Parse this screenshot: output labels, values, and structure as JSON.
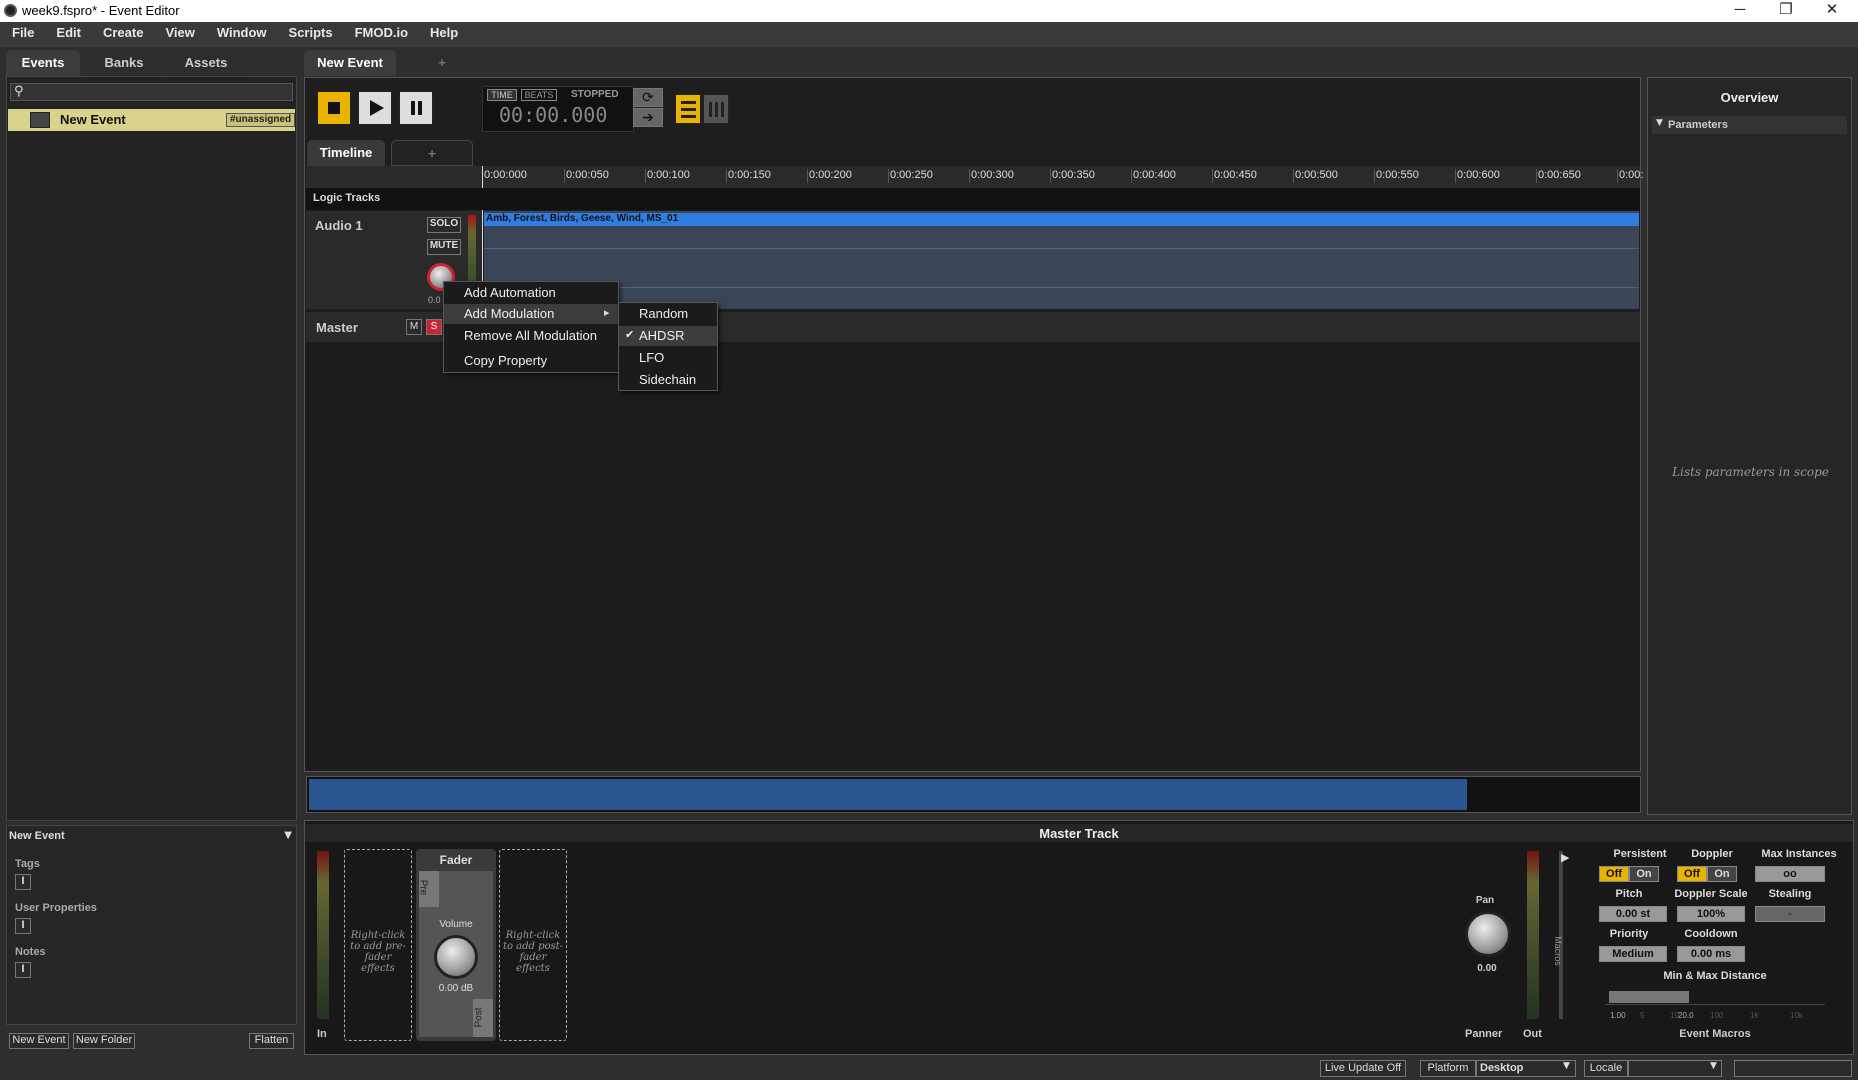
{
  "window": {
    "title": "week9.fspro* - Event Editor",
    "minimize": "─",
    "restore": "❐",
    "close": "✕"
  },
  "menu": [
    "File",
    "Edit",
    "Create",
    "View",
    "Window",
    "Scripts",
    "FMOD.io",
    "Help"
  ],
  "left": {
    "tabs": [
      "Events",
      "Banks",
      "Assets"
    ],
    "search_placeholder": "",
    "event": {
      "name": "New Event",
      "tag": "#unassigned"
    },
    "props": {
      "title": "New Event",
      "tags": "Tags",
      "user_properties": "User Properties",
      "notes": "Notes"
    },
    "buttons": {
      "new_event": "New Event",
      "new_folder": "New Folder",
      "flatten": "Flatten"
    }
  },
  "center": {
    "tab": "New Event",
    "add_tab": "+",
    "transport": {
      "time": "TIME",
      "beats": "BEATS",
      "status": "STOPPED",
      "clock": "00:00.000"
    },
    "timeline_tab": "Timeline",
    "timeline_add": "+",
    "ruler": [
      "0:00:000",
      "0:00:050",
      "0:00:100",
      "0:00:150",
      "0:00:200",
      "0:00:250",
      "0:00:300",
      "0:00:350",
      "0:00:400",
      "0:00:450",
      "0:00:500",
      "0:00:550",
      "0:00:600",
      "0:00:650",
      "0:00:"
    ],
    "logic_tracks": "Logic Tracks",
    "track": {
      "name": "Audio 1",
      "solo": "SOLO",
      "mute": "MUTE",
      "vol": "0.0",
      "clip": "Amb, Forest, Birds, Geese, Wind, MS_01"
    },
    "master": {
      "name": "Master",
      "m": "M",
      "s": "S"
    }
  },
  "context_menu": {
    "items": [
      "Add Automation",
      "Add Modulation",
      "Remove All Modulation",
      "Copy Property"
    ],
    "arrow": "▸"
  },
  "submenu": {
    "items": [
      "Random",
      "AHDSR",
      "LFO",
      "Sidechain"
    ],
    "checked": "AHDSR",
    "check": "✔"
  },
  "overview": {
    "title": "Overview",
    "section": "Parameters",
    "empty": "Lists parameters in scope"
  },
  "master_track": {
    "title": "Master Track",
    "pre_hint": "Right-click to add pre-fader effects",
    "post_hint": "Right-click to add post-fader effects",
    "fader": "Fader",
    "pre": "Pre",
    "post": "Post",
    "volume": "Volume",
    "volume_value": "0.00 dB",
    "in": "In",
    "out": "Out",
    "pan": "Pan",
    "pan_value": "0.00",
    "panner": "Panner",
    "macros": "Macros",
    "event_macros": {
      "title": "Event Macros",
      "persistent": "Persistent",
      "doppler": "Doppler",
      "max_instances": "Max Instances",
      "off": "Off",
      "on": "On",
      "max_value": "oo",
      "pitch": "Pitch",
      "pitch_value": "0.00 st",
      "doppler_scale": "Doppler Scale",
      "doppler_scale_value": "100%",
      "stealing": "Stealing",
      "stealing_value": "-",
      "priority": "Priority",
      "priority_value": "Medium",
      "cooldown": "Cooldown",
      "cooldown_value": "0.00 ms",
      "min_max": "Min & Max Distance",
      "min_value": "1.00",
      "max_value2": "20.0",
      "scale": [
        "1",
        "5",
        "10",
        "100",
        "1k",
        "10k"
      ]
    }
  },
  "statusbar": {
    "live_update": "Live Update Off",
    "platform_label": "Platform",
    "platform": "Desktop",
    "locale_label": "Locale",
    "locale": ""
  }
}
